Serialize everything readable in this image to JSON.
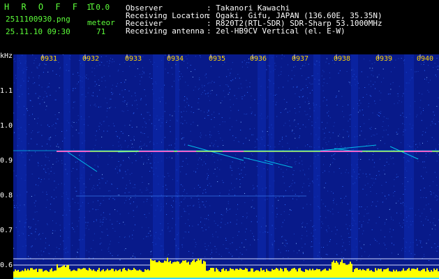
{
  "header": {
    "brand": "H R O F F T",
    "version": "1.0.0",
    "filename": "2511100930.png",
    "datetime": "25.11.10 09:30",
    "meteor_label": "meteor",
    "meteor_count": "71",
    "fields": [
      {
        "label": "Observer",
        "value": ": Takanori Kawachi"
      },
      {
        "label": "Receiving Location",
        "value": ": Ogaki, Gifu, JAPAN (136.60E, 35.35N)"
      },
      {
        "label": "Receiver",
        "value": ": R820T2(RTL-SDR) SDR-Sharp 53.1000MHz"
      },
      {
        "label": "Receiving antenna",
        "value": ": 2el-HB9CV Vertical (el. E-W)"
      }
    ]
  },
  "spectrogram": {
    "y_unit": "kHz",
    "y_ticks": [
      "1.1",
      "1.0",
      "0.9",
      "0.8",
      "0.7",
      "0.6"
    ],
    "x_ticks": [
      "0931",
      "0932",
      "0933",
      "0934",
      "0935",
      "0936",
      "0937",
      "0938",
      "0939",
      "0940"
    ],
    "colors": {
      "background": "#081a8a",
      "carrier": "#ff4fd8",
      "trace": "#00e5ff",
      "signal": "#ffff00",
      "noise": "#2d6bff",
      "x_labels": "#ffd400",
      "header_green": "#5dff3a"
    }
  }
}
